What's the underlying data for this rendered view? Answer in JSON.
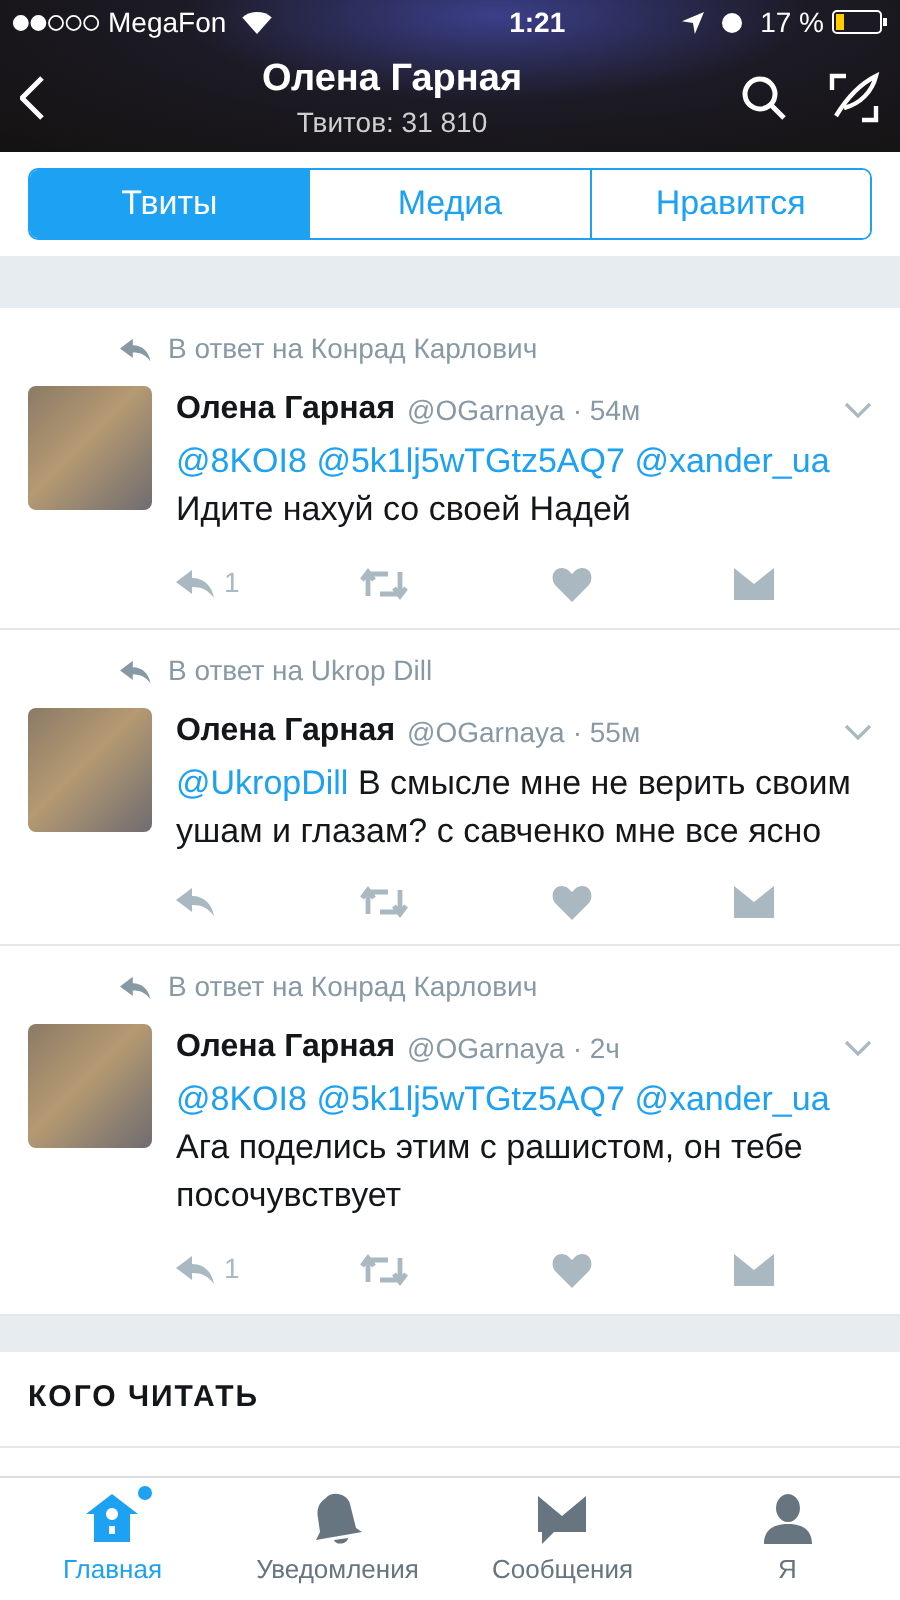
{
  "status_bar": {
    "carrier": "MegaFon",
    "time": "1:21",
    "battery": "17 %"
  },
  "header": {
    "title": "Олена Гарная",
    "subtitle": "Твитов: 31 810"
  },
  "tabs": [
    {
      "label": "Твиты",
      "selected": true
    },
    {
      "label": "Медиа",
      "selected": false
    },
    {
      "label": "Нравится",
      "selected": false
    }
  ],
  "tweets": [
    {
      "reply_to": "В ответ на Конрад Карлович",
      "name": "Олена Гарная",
      "handle": "@OGarnaya",
      "time": "· 54м",
      "mentions": [
        "@8KOI8",
        "@5k1lj5wTGtz5AQ7",
        "@xander_ua"
      ],
      "text": "Идите нахуй со своей Надей",
      "reply_count": "1"
    },
    {
      "reply_to": "В ответ на Ukrop Dill",
      "name": "Олена Гарная",
      "handle": "@OGarnaya",
      "time": "· 55м",
      "mentions": [
        "@UkropDill"
      ],
      "text": "В смысле мне не верить своим ушам и глазам? с савченко мне все ясно"
    },
    {
      "reply_to": "В ответ на Конрад Карлович",
      "name": "Олена Гарная",
      "handle": "@OGarnaya",
      "time": "· 2ч",
      "mentions": [
        "@8KOI8",
        "@5k1lj5wTGtz5AQ7",
        "@xander_ua"
      ],
      "text": "Ага поделись этим с рашистом, он тебе посочувствует",
      "reply_count": "1"
    }
  ],
  "who_to_follow": {
    "title": "КОГО ЧИТАТЬ"
  },
  "bottom_nav": [
    {
      "label": "Главная",
      "selected": true,
      "unread": true,
      "kind": "home"
    },
    {
      "label": "Уведомления",
      "selected": false,
      "unread": false,
      "kind": "bell"
    },
    {
      "label": "Сообщения",
      "selected": false,
      "unread": false,
      "kind": "mail"
    },
    {
      "label": "Я",
      "selected": false,
      "unread": false,
      "kind": "person"
    }
  ]
}
